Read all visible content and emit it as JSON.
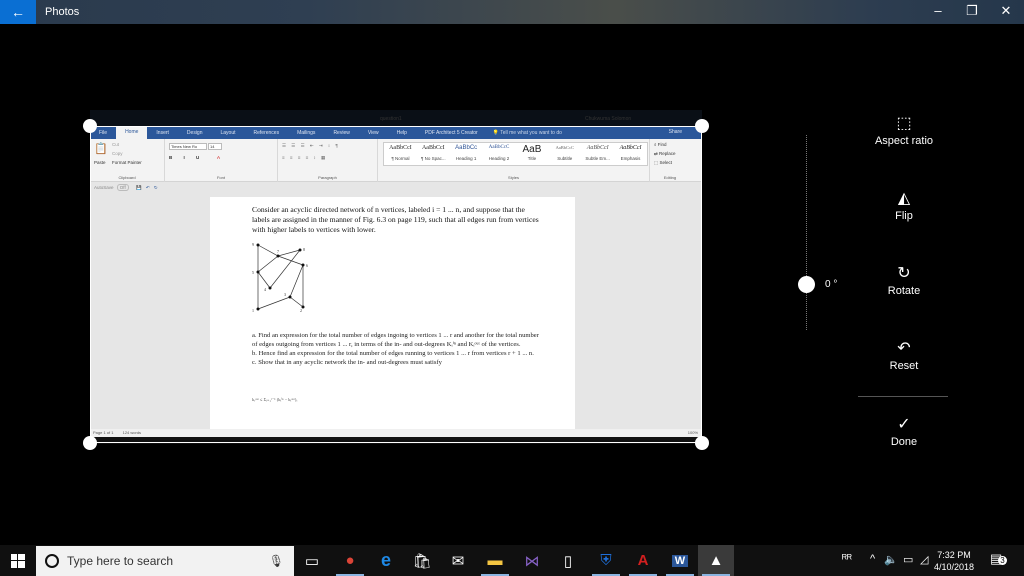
{
  "window": {
    "app_title": "Photos",
    "controls": {
      "minimize": "–",
      "maximize": "❐",
      "close": "✕"
    }
  },
  "word": {
    "window_title": "question1",
    "user": "Chukwuma Solomon",
    "tabs": [
      "File",
      "Home",
      "Insert",
      "Design",
      "Layout",
      "References",
      "Mailings",
      "Review",
      "View",
      "Help",
      "PDF Architect 5 Creator"
    ],
    "active_tab": "Home",
    "tell_me": "Tell me what you want to do",
    "share": "Share",
    "ribbon": {
      "clipboard": {
        "label": "Clipboard",
        "paste": "Paste",
        "cut": "Cut",
        "copy": "Copy",
        "format_painter": "Format Painter"
      },
      "font": {
        "label": "Font",
        "name": "Times New Ro",
        "size": "14"
      },
      "paragraph": {
        "label": "Paragraph"
      },
      "styles": {
        "label": "Styles",
        "items": [
          {
            "sample": "AaBbCcI",
            "name": "¶ Normal"
          },
          {
            "sample": "AaBbCcI",
            "name": "¶ No Spac..."
          },
          {
            "sample": "AaBbCc",
            "name": "Heading 1"
          },
          {
            "sample": "AaBbCcC",
            "name": "Heading 2"
          },
          {
            "sample": "AaB",
            "name": "Title"
          },
          {
            "sample": "AaBbCcC",
            "name": "Subtitle"
          },
          {
            "sample": "AaBbCcI",
            "name": "Subtle Em..."
          },
          {
            "sample": "AaBbCcI",
            "name": "Emphasis"
          }
        ]
      },
      "editing": {
        "label": "Editing",
        "find": "Find",
        "replace": "Replace",
        "select": "Select"
      }
    },
    "qat": {
      "autosave": "AutoSave",
      "autosave_state": "Off"
    },
    "document": {
      "intro": "Consider an acyclic directed network of n vertices, labeled i = 1 ... n, and suppose that the labels are assigned in the manner of Fig. 6.3 on page 119, such that all edges run from vertices with higher labels to vertices with lower.",
      "graph_nodes": [
        "9",
        "7",
        "8",
        "5",
        "6",
        "4",
        "3",
        "2",
        "1"
      ],
      "question_a": "a. Find an expression for the total number of edges ingoing to vertices 1 ... r and another for the total number of edges outgoing from vertices 1 ... r, in terms of the in- and out-degrees Kᵢⁱⁿ and Kᵢᵒᵘᵗ of the vertices.",
      "question_b": "b. Hence find an expression for the total number of edges running to vertices 1 ... r from vertices r + 1 ... n.",
      "question_c": "c. Show that in any acyclic network the in- and out-degrees must satisfy",
      "formula": "kᵣᵒᵘᵗ ≤ Σᵢ₌₁ʳ⁻¹ (kᵢⁱⁿ − kᵢᵒᵘᵗ),"
    },
    "status": {
      "page": "Page 1 of 1",
      "words": "124 words",
      "zoom": "100%"
    }
  },
  "crop_panel": {
    "angle": "0 °",
    "tools": [
      {
        "icon": "aspect-ratio-icon",
        "glyph": "⬚",
        "label": "Aspect ratio"
      },
      {
        "icon": "flip-icon",
        "glyph": "◭",
        "label": "Flip"
      },
      {
        "icon": "rotate-icon",
        "glyph": "↻",
        "label": "Rotate"
      },
      {
        "icon": "reset-icon",
        "glyph": "↶",
        "label": "Reset"
      },
      {
        "icon": "done-icon",
        "glyph": "✓",
        "label": "Done"
      }
    ]
  },
  "taskbar": {
    "search_placeholder": "Type here to search",
    "apps": [
      {
        "name": "task-view",
        "glyph": "▭"
      },
      {
        "name": "chrome",
        "glyph": "●",
        "color": "#db4437"
      },
      {
        "name": "edge",
        "glyph": "e",
        "color": "#1e88e5"
      },
      {
        "name": "store",
        "glyph": "🛍",
        "color": "#f0f0f0"
      },
      {
        "name": "mail",
        "glyph": "✉",
        "color": "#ffffff"
      },
      {
        "name": "file-explorer",
        "glyph": "▬",
        "color": "#f4c542"
      },
      {
        "name": "visual-studio",
        "glyph": "⋈",
        "color": "#8661c5"
      },
      {
        "name": "notepad",
        "glyph": "▯",
        "color": "#ffffff"
      },
      {
        "name": "vpn",
        "glyph": "⛨",
        "color": "#1e6fd9"
      },
      {
        "name": "acrobat",
        "glyph": "A",
        "color": "#d31f1f"
      },
      {
        "name": "word",
        "glyph": "W",
        "color": "#2b579a"
      },
      {
        "name": "photos",
        "glyph": "▲",
        "color": "#ffffff"
      }
    ],
    "clock_time": "7:32 PM",
    "clock_date": "4/10/2018",
    "notifications": "3"
  }
}
